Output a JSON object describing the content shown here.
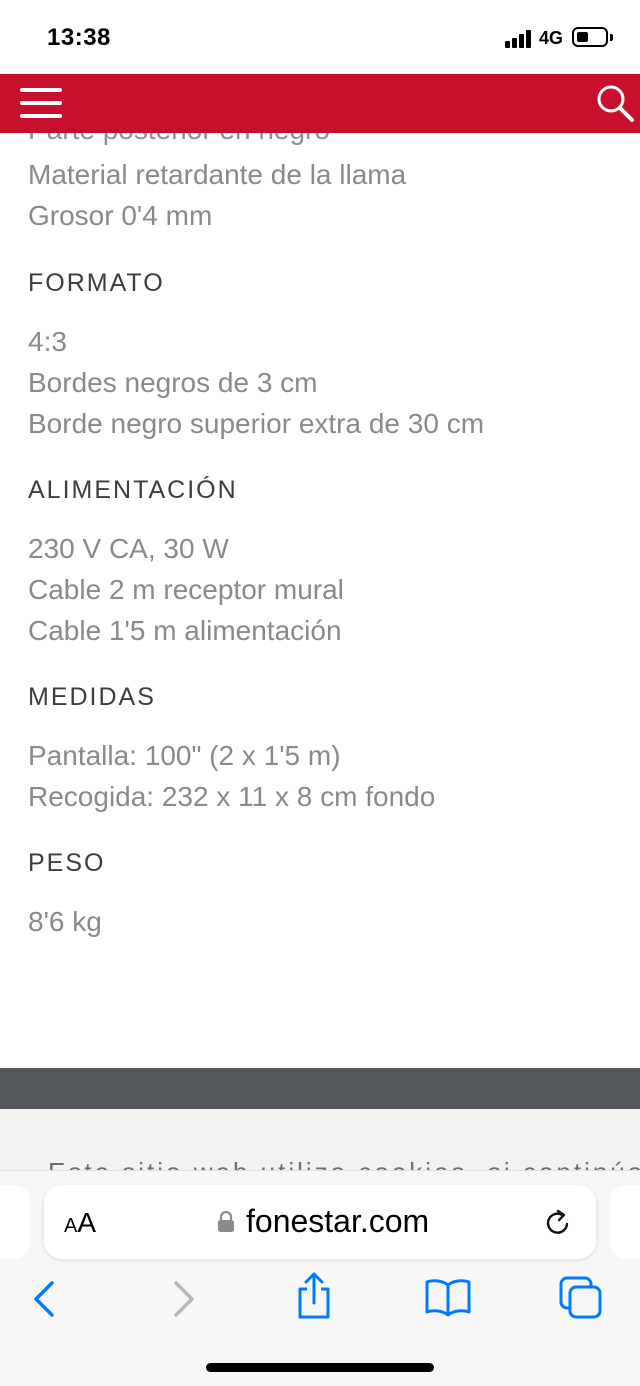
{
  "status_bar": {
    "time": "13:38",
    "network": "4G"
  },
  "header": {
    "menu_icon": "hamburger-menu-icon",
    "search_icon": "search-icon",
    "brand_color": "#c8102e"
  },
  "content": {
    "partial_top_line": "Parte posterior en negro",
    "intro_lines": [
      "Material retardante de la llama",
      "Grosor 0'4 mm"
    ],
    "sections": [
      {
        "title": "FORMATO",
        "lines": [
          "4:3",
          "Bordes negros de 3 cm",
          "Borde negro superior extra de 30 cm"
        ]
      },
      {
        "title": "ALIMENTACIÓN",
        "lines": [
          "230 V CA, 30 W",
          "Cable 2 m receptor mural",
          "Cable 1'5 m alimentación"
        ]
      },
      {
        "title": "MEDIDAS",
        "lines": [
          "Pantalla: 100\" (2 x 1'5 m)",
          "Recogida: 232 x 11 x 8 cm fondo"
        ]
      },
      {
        "title": "PESO",
        "lines": [
          "8'6 kg"
        ]
      }
    ]
  },
  "footer": {
    "cookie_text": "Este sitio web utiliza cookies, si continúa navegando"
  },
  "browser": {
    "text_size_label_small": "A",
    "text_size_label_large": "A",
    "url": "fonestar.com",
    "accent_color": "#007aff"
  }
}
